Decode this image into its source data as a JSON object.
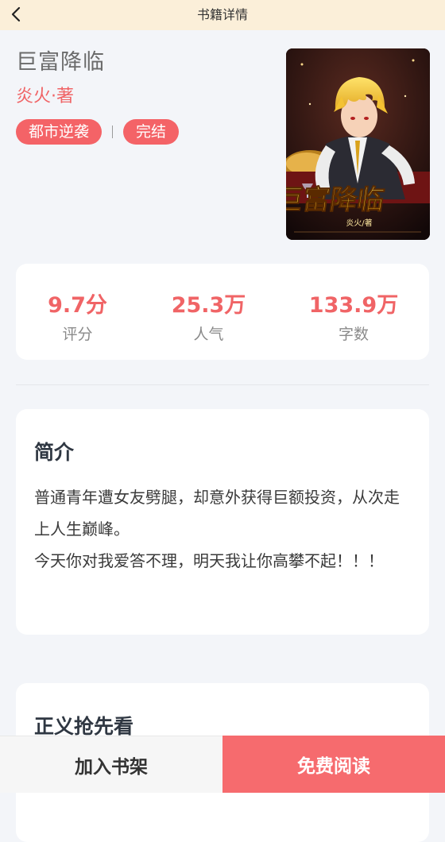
{
  "header": {
    "title": "书籍详情",
    "back_icon": "chevron-left-icon"
  },
  "book": {
    "title": "巨富降临",
    "author": "炎火·著",
    "tags": [
      "都市逆袭",
      "完结"
    ],
    "cover": {
      "title_text": "巨富降临",
      "author_text": "炎火/著"
    }
  },
  "stats": [
    {
      "value": "9.7分",
      "label": "评分"
    },
    {
      "value": "25.3万",
      "label": "人气"
    },
    {
      "value": "133.9万",
      "label": "字数"
    }
  ],
  "intro": {
    "title": "简介",
    "text": "普通青年遭女友劈腿，却意外获得巨额投资，从次走上人生巅峰。\n今天你对我爱答不理，明天我让你高攀不起！！！"
  },
  "preview": {
    "title": "正义抢先看"
  },
  "actions": {
    "add_shelf": "加入书架",
    "read_free": "免费阅读"
  },
  "colors": {
    "accent": "#f46367",
    "header_bg": "#fbefd9",
    "page_bg": "#f3f5f9"
  }
}
